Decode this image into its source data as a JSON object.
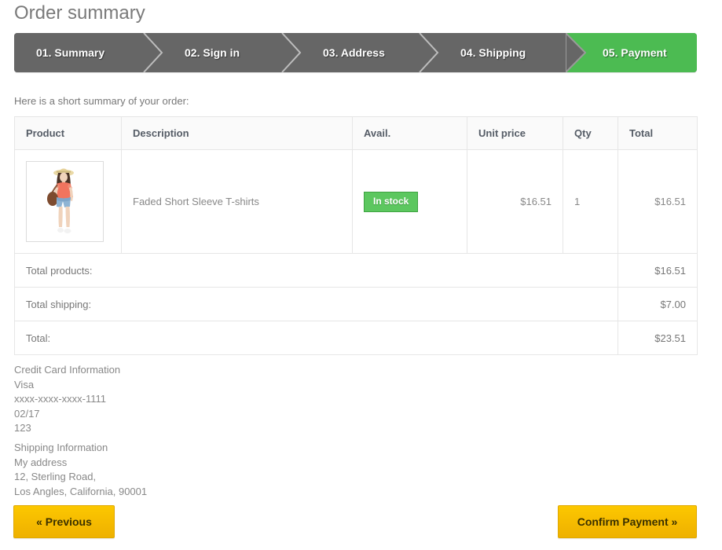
{
  "page_title": "Order summary",
  "steps": [
    {
      "label": "01. Summary",
      "state": "done"
    },
    {
      "label": "02. Sign in",
      "state": "done"
    },
    {
      "label": "03. Address",
      "state": "done"
    },
    {
      "label": "04. Shipping",
      "state": "done"
    },
    {
      "label": "05. Payment",
      "state": "active"
    }
  ],
  "intro_text": "Here is a short summary of your order:",
  "table": {
    "headers": {
      "product": "Product",
      "description": "Description",
      "avail": "Avail.",
      "unit_price": "Unit price",
      "qty": "Qty",
      "total": "Total"
    },
    "rows": [
      {
        "product_image_alt": "Faded Short Sleeve T-shirts",
        "description": "Faded Short Sleeve T-shirts",
        "availability": "In stock",
        "unit_price": "$16.51",
        "qty": "1",
        "total": "$16.51"
      }
    ],
    "totals": [
      {
        "label": "Total products:",
        "value": "$16.51"
      },
      {
        "label": "Total shipping:",
        "value": "$7.00"
      },
      {
        "label": "Total:",
        "value": "$23.51"
      }
    ]
  },
  "credit_card": {
    "heading": "Credit Card Information",
    "brand": "Visa",
    "number": "xxxx-xxxx-xxxx-1111",
    "expiry": "02/17",
    "cvv": "123"
  },
  "shipping": {
    "heading": "Shipping Information",
    "alias": "My address",
    "street": "12, Sterling Road,",
    "city_state_zip": "Los Angles, California, 90001"
  },
  "buttons": {
    "previous": "« Previous",
    "confirm": "Confirm Payment »"
  },
  "colors": {
    "step_done_bg": "#666666",
    "step_active_bg": "#4cbb52",
    "badge_green": "#5cc75f",
    "button_yellow": "#f5ba00",
    "table_border": "#e6e6e6",
    "header_bg": "#fafafa",
    "text_gray": "#888888",
    "title_gray": "#7a7a7a"
  }
}
